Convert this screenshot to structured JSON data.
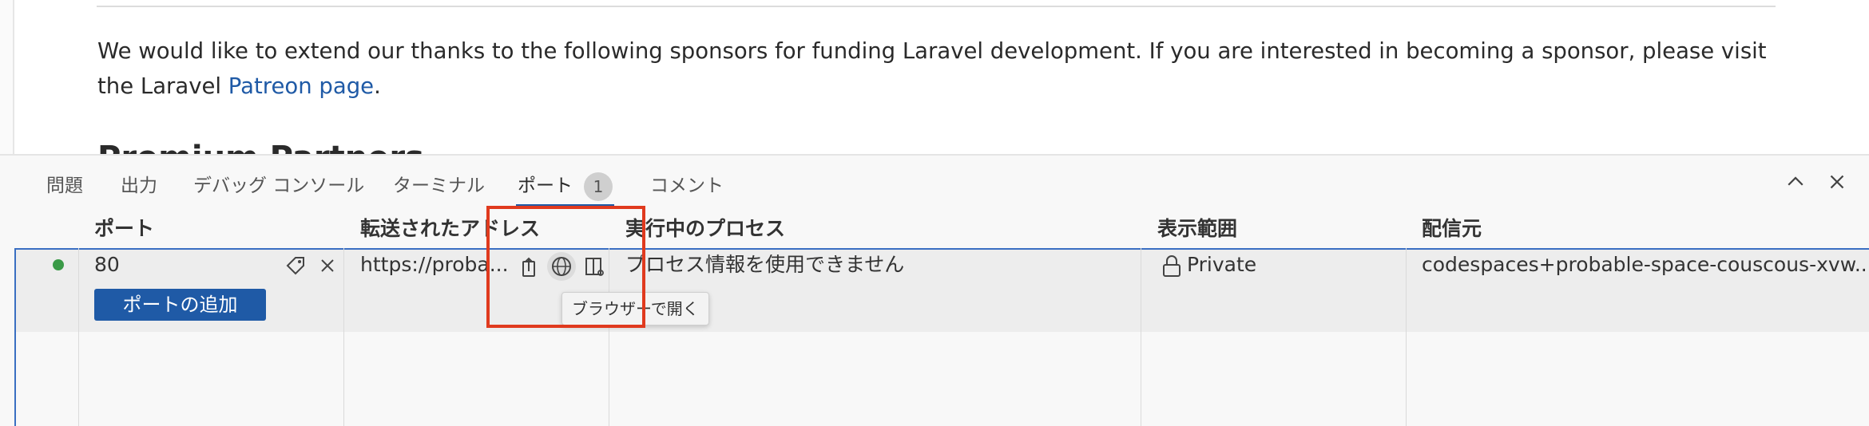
{
  "preview": {
    "paragraph_text": "We would like to extend our thanks to the following sponsors for funding Laravel development. If you are interested in becoming a sponsor, please visit the Laravel ",
    "link_text": "Patreon page",
    "after_link": ".",
    "cut_heading": "Premium Partners"
  },
  "panel": {
    "tabs": [
      {
        "label": "問題"
      },
      {
        "label": "出力"
      },
      {
        "label": "デバッグ コンソール"
      },
      {
        "label": "ターミナル"
      },
      {
        "label": "ポート",
        "badge": "1"
      },
      {
        "label": "コメント"
      }
    ],
    "active_tab": "ポート",
    "icons": {
      "collapse": "chevron-up-icon",
      "close": "close-icon"
    }
  },
  "ports_table": {
    "headers": [
      "ポート",
      "転送されたアドレス",
      "実行中のプロセス",
      "表示範囲",
      "配信元"
    ],
    "row": {
      "port": "80",
      "address": "https://proba...",
      "process": "プロセス情報を使用できません",
      "visibility": "Private",
      "origin": "codespaces+probable-space-couscous-xvw..."
    },
    "add_port_label": "ポートの追加",
    "tooltip": "ブラウザーで開く",
    "highlight_color": "#e03a1e",
    "accent": "#1f5aa6",
    "status_color": "#3a9a47"
  }
}
